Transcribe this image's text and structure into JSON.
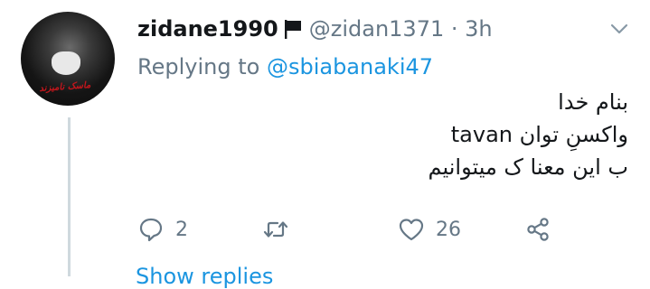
{
  "avatar": {
    "caption": "ماسک نامیزند"
  },
  "tweet": {
    "display_name": "zidane1990",
    "handle": "@zidan1371",
    "separator": "·",
    "time": "3h",
    "replying_prefix": "Replying to",
    "replying_to": "@sbiabanaki47",
    "body": "بنام خدا\nواکسنِ توان tavan\nب این معنا ک میتوانیم",
    "reply_count": "2",
    "retweet_count": "",
    "like_count": "26"
  },
  "icons": {
    "flag": "black-flag-icon",
    "menu": "chevron-down-icon",
    "reply": "reply-bubble-icon",
    "retweet": "retweet-icon",
    "like": "heart-icon",
    "share": "share-icon"
  },
  "colors": {
    "name": "#14171a",
    "secondary": "#657786",
    "link": "#1b95e0",
    "thread_line": "#cfd9de",
    "avatar_caption": "#c4161c"
  },
  "next_item_peek": "Show replies"
}
